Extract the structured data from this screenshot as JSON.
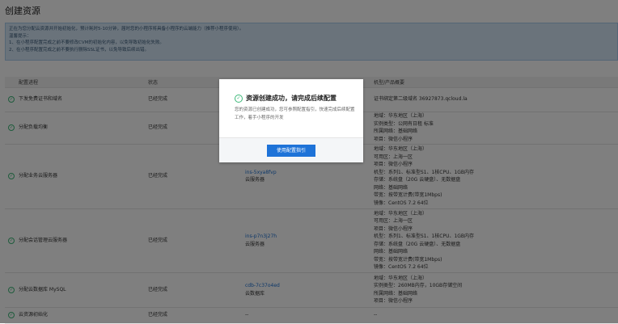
{
  "page": {
    "title": "创建资源"
  },
  "notice": {
    "lines": [
      "正在为您分配云资源并开始初始化，预计耗时5-10分钟，届时您的小程序将具备小程序的云端能力（推荐小程序使用）。",
      "温馨提示：",
      "1、在小程序配置完成之前不要修改CVM的初始化内容，以免导致初始化失败。",
      "2、在小程序配置完成之前不要执行删除SSL证书，以免导致后续出错。"
    ]
  },
  "table": {
    "headers": [
      "配置进程",
      "状态",
      "",
      "机型/产品概要"
    ],
    "rows": [
      {
        "name": "下发免费证书和域名",
        "status": "已经完成",
        "resource_id": "",
        "resource_type": "",
        "spec": [
          "证书绑定第二级域名 36927873.qcloud.la"
        ]
      },
      {
        "name": "分配负载均衡",
        "status": "已经完成",
        "resource_id": "",
        "resource_type": "",
        "spec": [
          "地域：华东地区（上海）",
          "实例类型：公网有日租 标准",
          "所属网络：基础网络",
          "项目：微信小程序"
        ]
      },
      {
        "name": "分配业务云服务器",
        "status": "已经完成",
        "resource_id": "ins-5xya8fvp",
        "resource_type": "云服务器",
        "spec": [
          "地域：华东地区（上海）",
          "可用区：上海一区",
          "项目：微信小程序",
          "机型：系列1、标准型S1、1核CPU、1GB内存",
          "存储：系统盘（20G 云硬盘）、无数据盘",
          "网络：基础网络",
          "带宽：按带宽计费(带宽1Mbps)",
          "镜像：CentOS 7.2 64位"
        ]
      },
      {
        "name": "分配会话管理云服务器",
        "status": "已经完成",
        "resource_id": "ins-p7n3j27h",
        "resource_type": "云服务器",
        "spec": [
          "地域：华东地区（上海）",
          "可用区：上海一区",
          "项目：微信小程序",
          "机型：系列1、标准型S1、1核CPU、1GB内存",
          "存储：系统盘（20G 云硬盘）、无数据盘",
          "网络：基础网络",
          "带宽：按带宽计费(带宽1Mbps)",
          "镜像：CentOS 7.2 64位"
        ]
      },
      {
        "name": "分配云数据库 MySQL",
        "status": "已经完成",
        "resource_id": "cdb-7c37o4ed",
        "resource_type": "云数据库",
        "spec": [
          "地域：华东地区（上海）",
          "实例类型：260MB内存，10GB存储空间",
          "所属网络：基础网络",
          "项目：微信小程序"
        ]
      },
      {
        "name": "云资源初始化",
        "status": "已经完成",
        "resource_id": "--",
        "resource_type": "",
        "spec": [
          "--"
        ]
      }
    ]
  },
  "modal": {
    "title": "资源创建成功，请完成后续配置",
    "body": "您的资源已创建成功，您可参照配置指引，快速完成后续配置工作，着手小程序的开发",
    "button": "使用配置指引",
    "icon": "check-circle-icon"
  },
  "colors": {
    "accent": "#1e73d8",
    "success": "#3cb878",
    "link": "#1a6fd1"
  }
}
